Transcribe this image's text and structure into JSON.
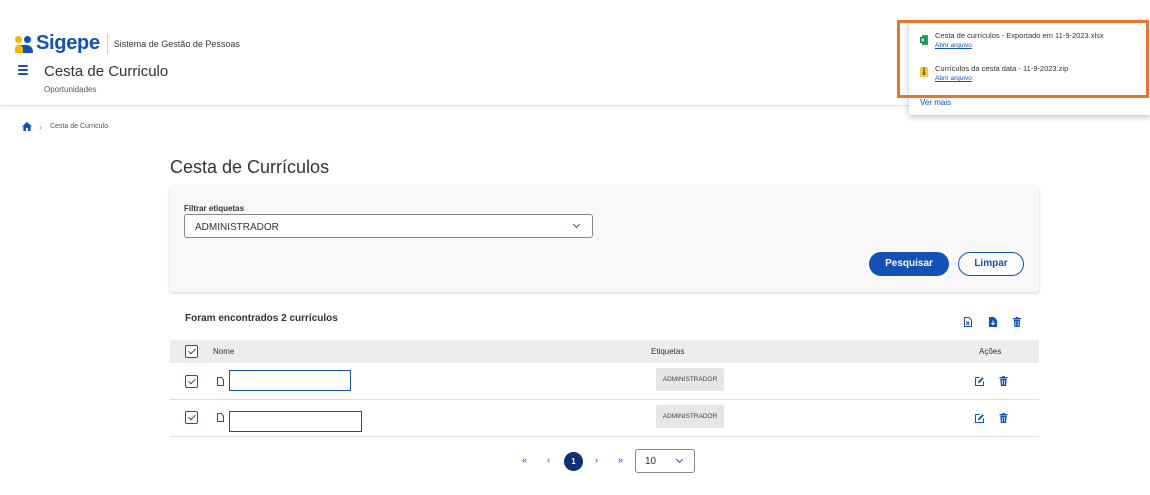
{
  "header": {
    "logo_text": "Sigepe",
    "logo_subtitle": "Sistema de Gestão de Pessoas",
    "title": "Cesta de Curriculo",
    "subtitle": "Oportunidades"
  },
  "breadcrumb": {
    "current": "Cesta de Curriculo"
  },
  "page": {
    "title": "Cesta de Currículos"
  },
  "filter": {
    "label": "Filtrar etiquetas",
    "selected": "ADMINISTRADOR",
    "search_label": "Pesquisar",
    "clear_label": "Limpar"
  },
  "results": {
    "count_text": "Foram encontrados 2 currículos",
    "columns": {
      "name": "Nome",
      "tags": "Etiquetas",
      "actions": "Ações"
    },
    "rows": [
      {
        "name": "",
        "tag": "ADMINISTRADOR",
        "checked": true
      },
      {
        "name": "",
        "tag": "ADMINISTRADOR",
        "checked": true
      }
    ]
  },
  "pagination": {
    "current_page": "1",
    "page_size": "10"
  },
  "downloads": {
    "items": [
      {
        "name": "Cesta de currículos - Exportado em 11-9-2023.xlsx",
        "action": "Abrir arquivo",
        "icon": "excel-file-icon"
      },
      {
        "name": "Currículos da cesta data - 11-9-2023.zip",
        "action": "Abrir arquivo",
        "icon": "zip-file-icon"
      }
    ],
    "more_label": "Ver mais"
  },
  "colors": {
    "primary": "#1351b4",
    "dark_primary": "#0c326f",
    "highlight": "#e8762d"
  }
}
